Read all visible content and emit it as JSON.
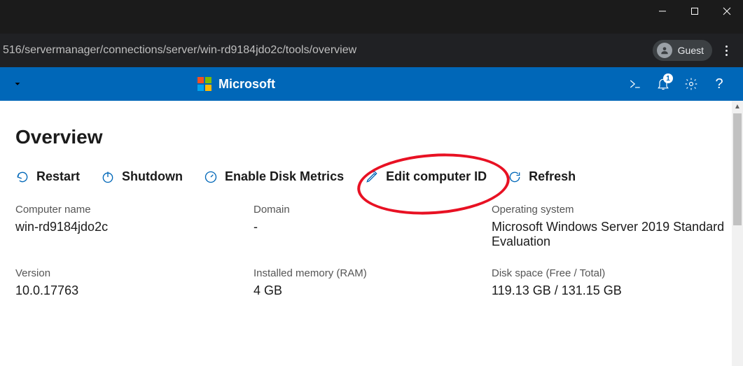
{
  "window": {
    "minimize": "─",
    "maximize": "▢",
    "close": "✕"
  },
  "browser": {
    "url": "516/servermanager/connections/server/win-rd9184jdo2c/tools/overview",
    "profile_label": "Guest"
  },
  "header": {
    "brand": "Microsoft",
    "notification_count": "1",
    "help_label": "?"
  },
  "page": {
    "title": "Overview",
    "actions": {
      "restart": "Restart",
      "shutdown": "Shutdown",
      "enable_disk_metrics": "Enable Disk Metrics",
      "edit_computer_id": "Edit computer ID",
      "refresh": "Refresh"
    },
    "labels": {
      "computer_name": "Computer name",
      "domain": "Domain",
      "operating_system": "Operating system",
      "version": "Version",
      "installed_memory": "Installed memory (RAM)",
      "disk_space": "Disk space (Free / Total)"
    },
    "values": {
      "computer_name": "win-rd9184jdo2c",
      "domain": "-",
      "operating_system": "Microsoft Windows Server 2019 Standard Evaluation",
      "version": "10.0.17763",
      "installed_memory": "4 GB",
      "disk_space": "119.13 GB / 131.15 GB"
    }
  }
}
